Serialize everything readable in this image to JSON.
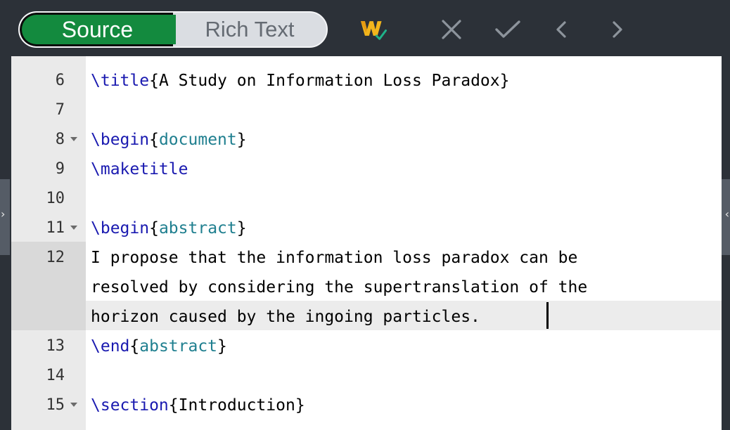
{
  "toolbar": {
    "source_label": "Source",
    "rich_text_label": "Rich Text",
    "icons": [
      "writefull-logo-icon",
      "close-icon",
      "check-icon",
      "chevron-left-icon",
      "chevron-right-icon"
    ]
  },
  "colors": {
    "source_active": "#138a3e",
    "command": "#1a1ab0",
    "argument": "#1f7f8f"
  },
  "editor": {
    "lines": [
      {
        "num": "6",
        "cmd": "\\title",
        "open": "{",
        "arg": "A Study on Information Loss Paradox",
        "close": "}"
      },
      {
        "num": "7"
      },
      {
        "num": "8",
        "cmd": "\\begin",
        "open": "{",
        "arg": "document",
        "close": "}"
      },
      {
        "num": "9",
        "cmd": "\\maketitle"
      },
      {
        "num": "10"
      },
      {
        "num": "11",
        "cmd": "\\begin",
        "open": "{",
        "arg": "abstract",
        "close": "}"
      },
      {
        "num": "12",
        "wrapped": [
          "I propose that the information loss paradox can be",
          "resolved by considering the supertranslation of the",
          "horizon caused by the ingoing particles. "
        ]
      },
      {
        "num": "13",
        "cmd": "\\end",
        "open": "{",
        "arg": "abstract",
        "close": "}"
      },
      {
        "num": "14"
      },
      {
        "num": "15",
        "cmd": "\\section",
        "open": "{",
        "arg": "Introduction",
        "close": "}"
      }
    ]
  }
}
